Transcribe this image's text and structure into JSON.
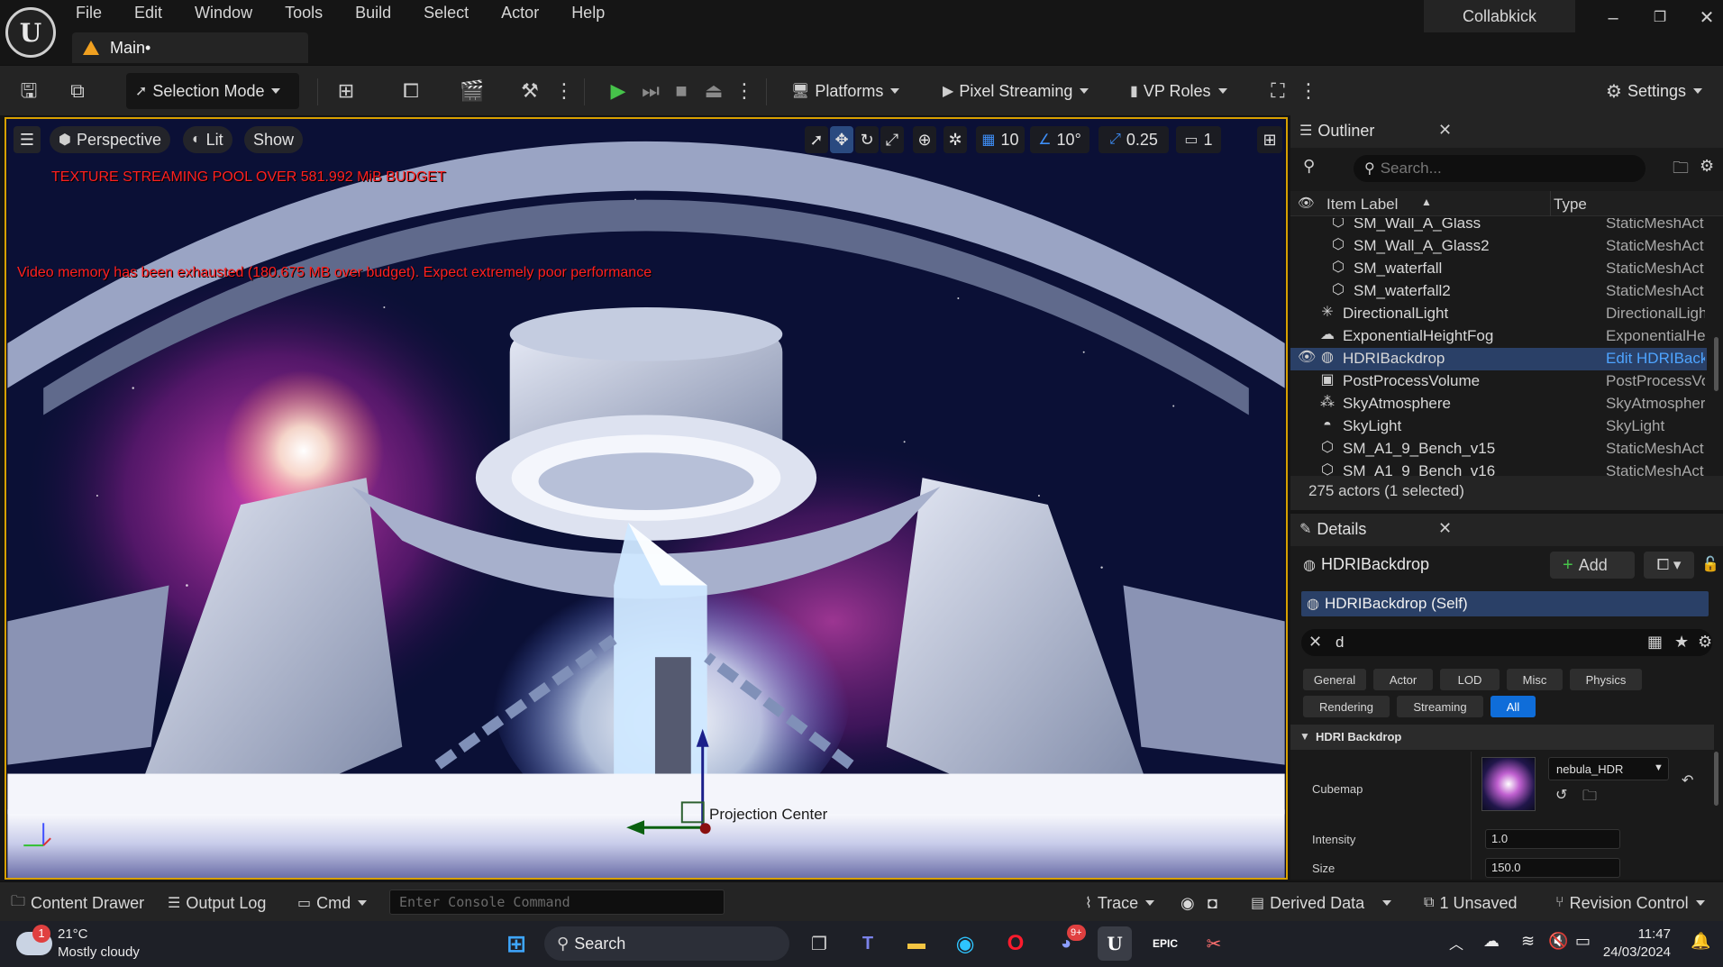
{
  "menu": [
    "File",
    "Edit",
    "Window",
    "Tools",
    "Build",
    "Select",
    "Actor",
    "Help"
  ],
  "doc_tab": "Main•",
  "project_name": "Collabkick",
  "toolbar": {
    "selection_mode": "Selection Mode",
    "platforms": "Platforms",
    "pixel_streaming": "Pixel Streaming",
    "vp_roles": "VP Roles",
    "settings": "Settings"
  },
  "viewport": {
    "perspective": "Perspective",
    "lit": "Lit",
    "show": "Show",
    "grid_snap": "10",
    "rotation_snap": "10°",
    "scale_snap": "0.25",
    "camera_speed": "1",
    "warning_texture": "TEXTURE STREAMING POOL OVER 581.992 MiB BUDGET",
    "warning_memory": "Video memory has been exhausted (180.675 MB over budget). Expect extremely poor performance",
    "projection_label": "Projection Center",
    "accent_color": "#d7a000",
    "warning_color": "#ff2020"
  },
  "outliner": {
    "title": "Outliner",
    "search_placeholder": "Search...",
    "col_label": "Item Label",
    "col_type": "Type",
    "rows": [
      {
        "label": "SM_Wall_A_Glass",
        "type": "StaticMeshAct",
        "icon": "mesh-icon"
      },
      {
        "label": "SM_Wall_A_Glass2",
        "type": "StaticMeshAct",
        "icon": "mesh-icon"
      },
      {
        "label": "SM_waterfall",
        "type": "StaticMeshAct",
        "icon": "mesh-icon"
      },
      {
        "label": "SM_waterfall2",
        "type": "StaticMeshAct",
        "icon": "mesh-icon"
      },
      {
        "label": "DirectionalLight",
        "type": "DirectionalLigh",
        "icon": "sun-icon"
      },
      {
        "label": "ExponentialHeightFog",
        "type": "ExponentialHei",
        "icon": "fog-icon"
      },
      {
        "label": "HDRIBackdrop",
        "type": "Edit HDRIBack",
        "icon": "sphere-icon"
      },
      {
        "label": "PostProcessVolume",
        "type": "PostProcessVo",
        "icon": "volume-icon"
      },
      {
        "label": "SkyAtmosphere",
        "type": "SkyAtmospher",
        "icon": "atmosphere-icon"
      },
      {
        "label": "SkyLight",
        "type": "SkyLight",
        "icon": "skylight-icon"
      },
      {
        "label": "SM_A1_9_Bench_v15",
        "type": "StaticMeshAct",
        "icon": "mesh-icon"
      },
      {
        "label": "SM_A1_9_Bench_v16",
        "type": "StaticMeshAct",
        "icon": "mesh-icon"
      }
    ],
    "footer": "275 actors (1 selected)"
  },
  "details": {
    "title": "Details",
    "actor_name": "HDRIBackdrop",
    "add_label": "Add",
    "component_self": "HDRIBackdrop (Self)",
    "search_value": "d",
    "filters": [
      "General",
      "Actor",
      "LOD",
      "Misc",
      "Physics",
      "Rendering",
      "Streaming",
      "All"
    ],
    "section": "HDRI Backdrop",
    "cubemap_label": "Cubemap",
    "cubemap_value": "nebula_HDR",
    "intensity_label": "Intensity",
    "intensity_value": "1.0",
    "size_label": "Size",
    "size_value": "150.0"
  },
  "statusbar": {
    "content_drawer": "Content Drawer",
    "output_log": "Output Log",
    "cmd": "Cmd",
    "console_placeholder": "Enter Console Command",
    "trace": "Trace",
    "derived_data": "Derived Data",
    "unsaved": "1 Unsaved",
    "revision_control": "Revision Control"
  },
  "taskbar": {
    "weather_temp": "21°C",
    "weather_desc": "Mostly cloudy",
    "weather_badge": "1",
    "search": "Search",
    "discord_badge": "9+",
    "time": "11:47",
    "date": "24/03/2024"
  }
}
